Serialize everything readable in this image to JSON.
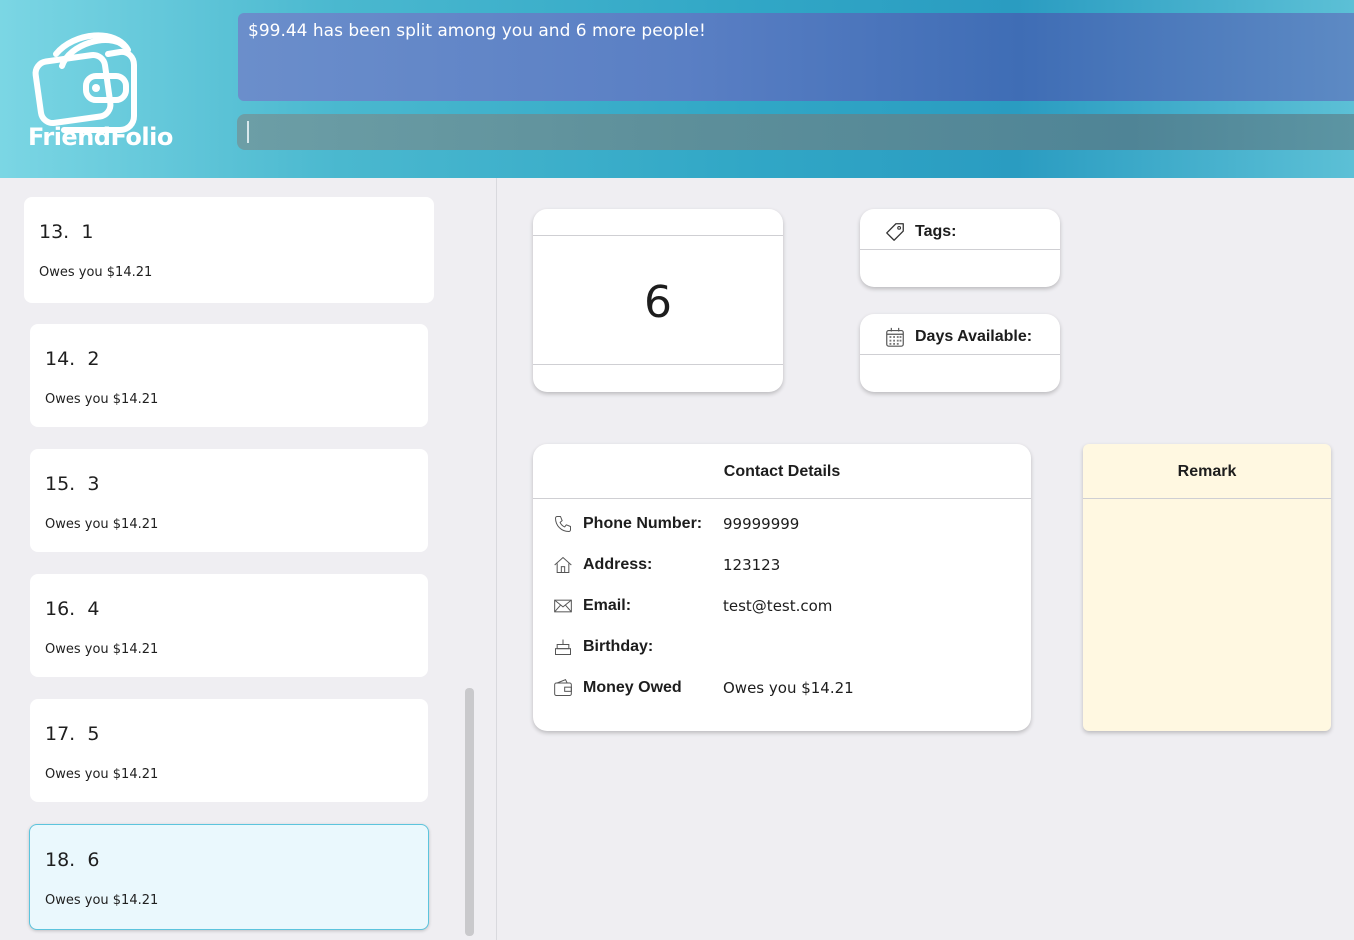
{
  "header": {
    "app_name": "FriendFolio",
    "result_message": "$99.44 has been split among you and 6 more people!",
    "command_value": ""
  },
  "persons": [
    {
      "index": "13.",
      "name": "1",
      "owed": "Owes you $14.21"
    },
    {
      "index": "14.",
      "name": "2",
      "owed": "Owes you $14.21"
    },
    {
      "index": "15.",
      "name": "3",
      "owed": "Owes you $14.21"
    },
    {
      "index": "16.",
      "name": "4",
      "owed": "Owes you $14.21"
    },
    {
      "index": "17.",
      "name": "5",
      "owed": "Owes you $14.21"
    },
    {
      "index": "18.",
      "name": "6",
      "owed": "Owes you $14.21"
    }
  ],
  "selected_index": 5,
  "detail": {
    "name": "6",
    "tags_label": "Tags:",
    "days_label": "Days Available:",
    "contact_title": "Contact Details",
    "phone_label": "Phone Number:",
    "phone": "99999999",
    "address_label": "Address:",
    "address": "123123",
    "email_label": "Email:",
    "email": "test@test.com",
    "birthday_label": "Birthday:",
    "birthday": "",
    "money_label": "Money Owed",
    "money": "Owes you $14.21",
    "remark_title": "Remark",
    "remark": ""
  },
  "colors": {
    "accent": "#5cc4dd",
    "remark_bg": "#fff8e1",
    "selected_bg": "#eaf8fd"
  }
}
